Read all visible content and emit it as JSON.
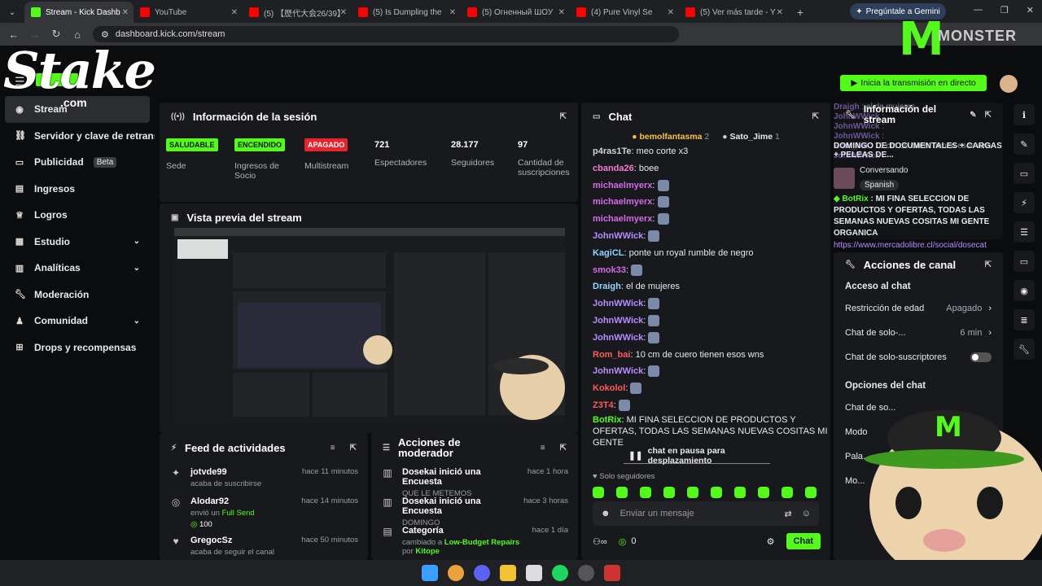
{
  "browser": {
    "tabs": [
      {
        "label": "Stream - Kick Dashb",
        "color": "#53fc18"
      },
      {
        "label": "YouTube",
        "color": "#ff0000"
      },
      {
        "label": "(5) 【歴代大会26/39】",
        "color": "#ff0000"
      },
      {
        "label": "(5) Is Dumpling the",
        "color": "#ff0000"
      },
      {
        "label": "(5) Огненный ШОУ",
        "color": "#ff0000"
      },
      {
        "label": "(4) Pure Vinyl Se",
        "color": "#ff0000"
      },
      {
        "label": "(5) Ver más tarde - Y",
        "color": "#ff0000"
      }
    ],
    "new_tab": "+",
    "gemini": "Pregúntale a Gemini",
    "url": "dashboard.kick.com/stream"
  },
  "overlay": {
    "stake_logo": "Stake",
    "stake_sub": ".com",
    "monster_logo": "MONSTER"
  },
  "sidebar": {
    "items": [
      {
        "label": "Stream",
        "icon": "broadcast-icon"
      },
      {
        "label": "Servidor y clave de retransmisión",
        "icon": "link-icon"
      },
      {
        "label": "Publicidad",
        "icon": "ad-icon",
        "badge": "Beta"
      },
      {
        "label": "Ingresos",
        "icon": "chart-icon"
      },
      {
        "label": "Logros",
        "icon": "trophy-icon"
      },
      {
        "label": "Estudio",
        "icon": "grid-icon",
        "chevron": true
      },
      {
        "label": "Analíticas",
        "icon": "analytics-icon",
        "chevron": true
      },
      {
        "label": "Moderación",
        "icon": "wrench-icon"
      },
      {
        "label": "Comunidad",
        "icon": "community-icon",
        "chevron": true
      },
      {
        "label": "Drops y recompensas",
        "icon": "gift-icon"
      }
    ]
  },
  "session": {
    "title": "Información de la sesión",
    "stats": [
      {
        "badge": "SALUDABLE",
        "badge_color": "#53fc18",
        "label": "Sede"
      },
      {
        "badge": "ENCENDIDO",
        "badge_color": "#53fc18",
        "label": "Ingresos de Socio"
      },
      {
        "badge": "APAGADO",
        "badge_color": "#e5242b",
        "label": "Multistream"
      },
      {
        "value": "721",
        "label": "Espectadores"
      },
      {
        "value": "28.177",
        "label": "Seguidores"
      },
      {
        "value": "97",
        "label": "Cantidad de suscripciones"
      }
    ]
  },
  "preview": {
    "title": "Vista previa del stream"
  },
  "feed": {
    "title": "Feed de actividades",
    "items": [
      {
        "name": "jotvde99",
        "sub": "acaba de suscribirse",
        "time": "hace 11 minutos",
        "icon": "star-icon"
      },
      {
        "name": "Alodar92",
        "sub_prefix": "envió un ",
        "sub_hl": "Full Send",
        "amount": "100",
        "time": "hace 14 minutos",
        "icon": "kick-coin-icon"
      },
      {
        "name": "GregocSz",
        "sub": "acaba de seguir el canal",
        "time": "hace 50 minutos",
        "icon": "heart-icon"
      }
    ]
  },
  "modactions": {
    "title": "Acciones de moderador",
    "items": [
      {
        "name": "Dosekai",
        "action": " inició una Encuesta",
        "sub": "QUE LE METEMOS",
        "time": "hace 1 hora"
      },
      {
        "name": "Dosekai",
        "action": " inició una Encuesta",
        "sub": "DOMINGO",
        "time": "hace 3 horas"
      },
      {
        "name": "Categoría",
        "action": "",
        "sub_prefix": "cambiado a ",
        "sub_hl": "Low-Budget Repairs",
        "sub_mid": " por ",
        "sub_hl2": "Kitope",
        "time": "hace 1 día"
      }
    ]
  },
  "chat": {
    "title": "Chat",
    "top_gifters": [
      {
        "name": "bemolfantasma",
        "count": "2"
      },
      {
        "name": "Sato_Jime",
        "count": "1"
      }
    ],
    "messages": [
      {
        "user": "p4ras1Te",
        "color": "#cfd3d8",
        "text": "meo corte x3"
      },
      {
        "user": "cbanda26",
        "color": "#f17bd1",
        "text": "boee"
      },
      {
        "user": "michaelmyerx",
        "color": "#d36be8",
        "text": ""
      },
      {
        "user": "michaelmyerx",
        "color": "#d36be8",
        "text": ""
      },
      {
        "user": "michaelmyerx",
        "color": "#d36be8",
        "text": ""
      },
      {
        "user": "JohnWWick",
        "color": "#b78cff",
        "text": ""
      },
      {
        "user": "KagiCL",
        "color": "#93d5ff",
        "text": "ponte un royal rumble de negro"
      },
      {
        "user": "smok33",
        "color": "#d36be8",
        "text": ""
      },
      {
        "user": "Draigh",
        "color": "#93d5ff",
        "text": "el de mujeres"
      },
      {
        "user": "JohnWWick",
        "color": "#b78cff",
        "text": ""
      },
      {
        "user": "JohnWWick",
        "color": "#b78cff",
        "text": ""
      },
      {
        "user": "JohnWWick",
        "color": "#b78cff",
        "text": ""
      },
      {
        "user": "Rom_bai",
        "color": "#ff5a5a",
        "text": "10 cm de cuero tienen esos wns"
      },
      {
        "user": "JohnWWick",
        "color": "#b78cff",
        "text": ""
      },
      {
        "user": "Kokolol",
        "color": "#ff5a5a",
        "text": ""
      },
      {
        "user": "Z3T4",
        "color": "#ff5a5a",
        "text": ""
      },
      {
        "user": "BotRix",
        "color": "#53fc18",
        "text": "MI FINA SELECCION DE PRODUCTOS Y OFERTAS, TODAS LAS SEMANAS NUEVAS COSITAS MI GENTE"
      }
    ],
    "paused": "chat en pausa para desplazamiento",
    "followers_only": "Solo seguidores",
    "input_placeholder": "Enviar un mensaje",
    "points": "0",
    "send": "Chat"
  },
  "stream_info": {
    "title": "Información del stream",
    "live_button": "Inicia la transmisión en directo",
    "overlay_lines": [
      {
        "user": "Draigh",
        "text": "el de mujeres"
      },
      {
        "user": "JohnWWick",
        "text": ""
      },
      {
        "user": "JohnWWick",
        "text": ""
      },
      {
        "user": "JohnWWick",
        "text": ""
      },
      {
        "user": "Rom_bai",
        "text": "10 cm de cuero tienen esos wns"
      },
      {
        "user": "JohnWWick",
        "text": ""
      }
    ],
    "stream_title": "DOMINGO DE DOCUMENTALES + CARGAS + PELEAS DE...",
    "category": "Conversando",
    "language": "Spanish",
    "botrix": "MI FINA SELECCION DE PRODUCTOS Y OFERTAS, TODAS LAS SEMANAS NUEVAS COSITAS MI GENTE ORGANICA",
    "botrix_link": "https://www.mercadolibre.cl/social/dosecat"
  },
  "channel_actions": {
    "title": "Acciones de canal",
    "chat_access": "Acceso al chat",
    "rows": [
      {
        "label": "Restricción de edad",
        "value": "Apagado"
      },
      {
        "label": "Chat de solo-...",
        "value": "6 min"
      },
      {
        "label": "Chat de solo-suscriptores",
        "value": ""
      }
    ],
    "chat_options": "Opciones del chat",
    "options_rows": [
      "Chat de so...",
      "Modo",
      "Pala...",
      "Mo..."
    ]
  }
}
